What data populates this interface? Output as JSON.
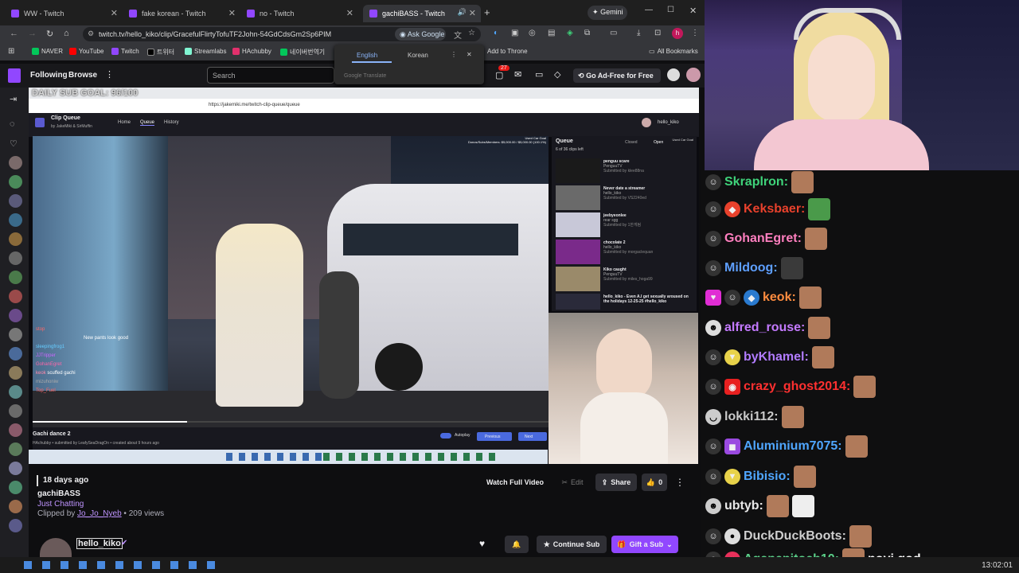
{
  "browser": {
    "tabs": [
      {
        "title": "WW - Twitch"
      },
      {
        "title": "fake korean - Twitch"
      },
      {
        "title": "no - Twitch"
      },
      {
        "title": "gachiBASS - Twitch"
      }
    ],
    "gemini_label": "Gemini",
    "url": "twitch.tv/hello_kiko/clip/GracefulFlirtyTofuTF2John-54GdCdsGm2Sp6PIM",
    "ask_google": "Ask Google",
    "bookmarks": [
      {
        "label": "NAVER",
        "color": "#03c75a"
      },
      {
        "label": "YouTube",
        "color": "#ff0000"
      },
      {
        "label": "Twitch",
        "color": "#9147ff"
      },
      {
        "label": "트위터",
        "color": "#000000"
      },
      {
        "label": "Streamlabs",
        "color": "#80f5d2"
      },
      {
        "label": "HAchubby",
        "color": "#e1306c"
      },
      {
        "label": "네이버번역기",
        "color": "#03c75a"
      }
    ],
    "bookmark_throne": "Add to Throne",
    "all_bookmarks": "All Bookmarks",
    "translate_popup": {
      "lang1": "English",
      "lang2": "Korean",
      "footer": "Google Translate"
    }
  },
  "twitch": {
    "nav_following": "Following",
    "nav_browse": "Browse",
    "search_placeholder": "Search",
    "notif_count": "27",
    "ad_free": "Go Ad-Free for Free"
  },
  "clip_player": {
    "overlay_goal": "DAILY SUB GOAL: 96/100",
    "inner_url": "https://jakemiki.me/twitch-clip-queue/queue",
    "app_title": "Clip Queue",
    "app_sub": "by JakeMiki & SirMuffin",
    "nav": [
      "Home",
      "Queue",
      "History"
    ],
    "user": "hello_kiko",
    "car_goal": "Used Car Goal",
    "car_goal_sub": "Donos/Subs/Members: $5,000.00 / $5,000.00 (100.1%)",
    "queue_title": "Queue",
    "queue_count": "6 of 36 clips left",
    "queue_closed": "Closed",
    "queue_open": "Open",
    "queue_items": [
      {
        "title": "penguu scare",
        "sub": "PenguuTV",
        "by": "Submitted by klee88na",
        "color": "#1a1a1a"
      },
      {
        "title": "Never date a streamer",
        "sub": "hello_kiko",
        "by": "Submitted by VS2240ed",
        "color": "#6a6a6a"
      },
      {
        "title": "jeebyeonlee",
        "sub": "rear sgg",
        "by": "Submitted by 1한게됨",
        "color": "#c8c8d8"
      },
      {
        "title": "chocolate 2",
        "sub": "hello_kiko",
        "by": "Submitted by morgaclequan",
        "color": "#7a2a8a"
      },
      {
        "title": "Kiko caught",
        "sub": "PenguuTV",
        "by": "Submitted by miles_hoga99",
        "color": "#9a8a6a"
      },
      {
        "title": "hello_kiko - Even A.I get sexually aroused on the holidays 12-25-25 #hello_kiko",
        "sub": "",
        "by": "",
        "color": "#2a2a3a"
      }
    ],
    "clip_title": "Gachi dance 2",
    "clip_meta": "HAchubby • submitted by LeafySeaDragOn • created about 9 hours ago",
    "autoplay": "Autoplay",
    "prev": "Previous",
    "next": "Next",
    "chat_overlay": [
      {
        "name": "stop",
        "text": "",
        "color": "#ff6a6a"
      },
      {
        "name": "",
        "text": "New pants look good",
        "color": "#9cf"
      },
      {
        "name": "sleepingfrog1",
        "text": "",
        "color": "#6cf"
      },
      {
        "name": "JJTripper",
        "text": "",
        "color": "#c6f"
      },
      {
        "name": "GohanEgret",
        "text": "",
        "color": "#f6a"
      },
      {
        "name": "keok",
        "text": "scuffed gachi",
        "color": "#f8a"
      },
      {
        "name": "mizuhoniw",
        "text": "",
        "color": "#aaa"
      },
      {
        "name": "Top_Fuel",
        "text": "",
        "color": "#f66"
      }
    ]
  },
  "clip_info": {
    "age": "18 days ago",
    "title": "gachiBASS",
    "category": "Just Chatting",
    "clipped_by_prefix": "Clipped by",
    "clipper": "Jo_Jo_Nyeb",
    "views": "• 209 views",
    "watch_full": "Watch Full Video",
    "edit": "Edit",
    "share": "Share",
    "likes": "0",
    "channel": "hello_kiko",
    "continue_sub": "Continue Sub",
    "gift_sub": "Gift a Sub"
  },
  "chat": [
    {
      "user": "Skraplron:",
      "color": "#3fd37a",
      "emotes": 1,
      "text": ""
    },
    {
      "user": "Keksbaer:",
      "color": "#e8412c",
      "emotes": 1,
      "text": ""
    },
    {
      "user": "GohanEgret:",
      "color": "#ff7fbf",
      "emotes": 1,
      "text": ""
    },
    {
      "user": "Mildoog:",
      "color": "#5e9fff",
      "emotes": 1,
      "text": ""
    },
    {
      "user": "keok:",
      "color": "#ff8c3f",
      "emotes": 1,
      "text": ""
    },
    {
      "user": "alfred_rouse:",
      "color": "#c47aff",
      "emotes": 1,
      "text": ""
    },
    {
      "user": "byKhamel:",
      "color": "#b27cff",
      "emotes": 1,
      "text": ""
    },
    {
      "user": "crazy_ghost2014:",
      "color": "#ff3030",
      "emotes": 1,
      "text": ""
    },
    {
      "user": "lokki112:",
      "color": "#c9c9c9",
      "emotes": 1,
      "text": ""
    },
    {
      "user": "Aluminium7075:",
      "color": "#4fa6ff",
      "emotes": 1,
      "text": ""
    },
    {
      "user": "Bibisio:",
      "color": "#4fa6ff",
      "emotes": 1,
      "text": ""
    },
    {
      "user": "ubtyb:",
      "color": "#e8e8e8",
      "emotes": 2,
      "text": ""
    },
    {
      "user": "DuckDuckBoots:",
      "color": "#cfcfcf",
      "emotes": 1,
      "text": ""
    },
    {
      "user": "Agapepitoch10:",
      "color": "#5cd18a",
      "emotes": 1,
      "text": "novi god"
    }
  ],
  "clock": "13:02:01"
}
